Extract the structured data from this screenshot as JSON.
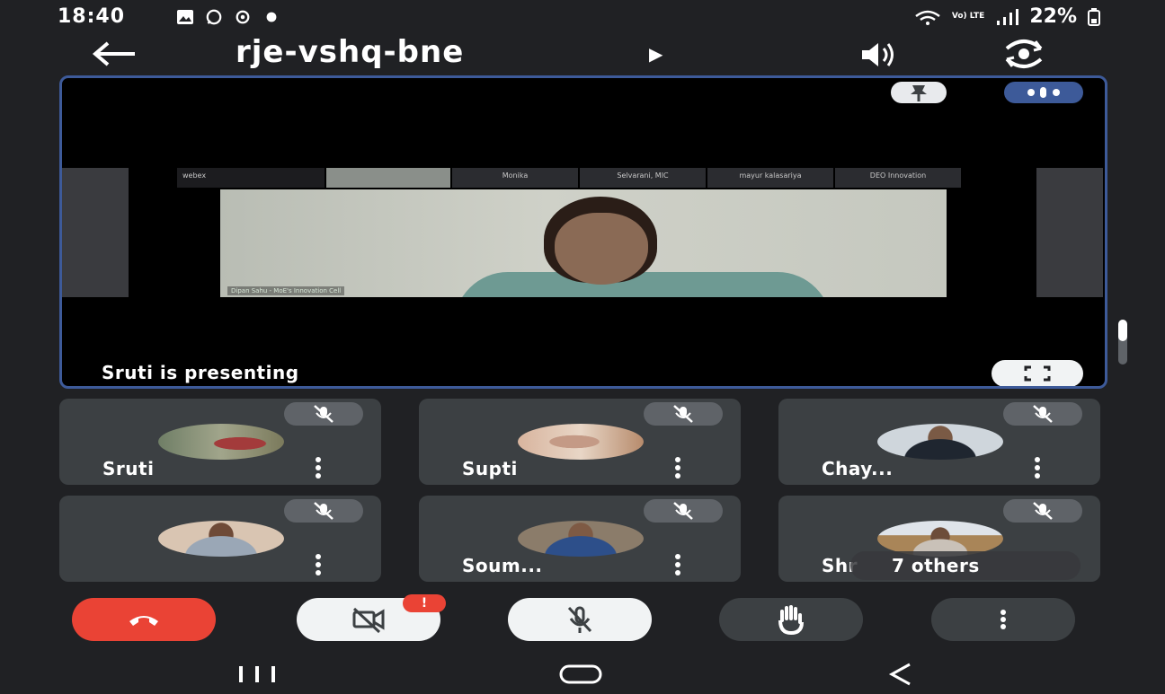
{
  "status_bar": {
    "time": "18:40",
    "battery": "22%",
    "network": "Vo) LTE"
  },
  "header": {
    "meeting_code": "rje-vshq-bne",
    "icons": [
      "back-arrow-icon",
      "caret-right-icon",
      "speaker-icon",
      "switch-camera-icon"
    ]
  },
  "presentation": {
    "status_text": "Sruti is presenting",
    "shared_screen": {
      "strip_names": [
        "Monika",
        "Selvarani, MIC",
        "mayur kalasariya",
        "DEO Innovation"
      ],
      "logo_text": "webex",
      "caption": "Dipan Sahu - MoE's Innovation Cell"
    }
  },
  "participants": [
    {
      "name": "Sruti",
      "muted": true
    },
    {
      "name": "Supti",
      "muted": true
    },
    {
      "name": "Chay...",
      "muted": true
    },
    {
      "name": "",
      "muted": true
    },
    {
      "name": "Soum...",
      "muted": true
    },
    {
      "name": "Shr",
      "muted": true,
      "overflow_label": "7 others"
    }
  ],
  "controls": {
    "camera_alert": "!",
    "icons": [
      "end-call-icon",
      "camera-off-icon",
      "mic-off-icon",
      "raise-hand-icon",
      "more-options-icon"
    ]
  },
  "colors": {
    "background": "#202124",
    "tile": "#3c4043",
    "end_call": "#ea4335",
    "accent_border": "#3d5a99"
  }
}
